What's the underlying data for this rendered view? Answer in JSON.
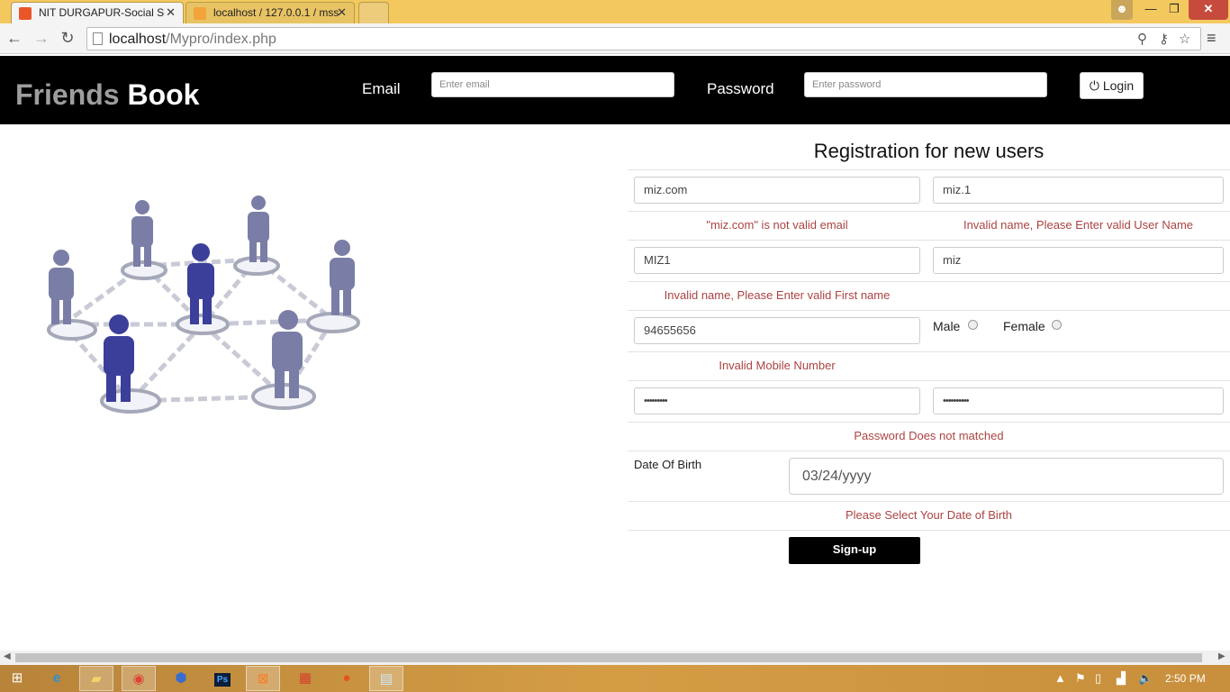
{
  "browser": {
    "tabs": [
      {
        "title": "NIT DURGAPUR-Social Site",
        "active": true,
        "favicon": "xampp-icon"
      },
      {
        "title": "localhost / 127.0.0.1 / mss",
        "active": false,
        "favicon": "phpmyadmin-icon"
      }
    ],
    "url_host": "localhost",
    "url_path": "/Mypro/index.php"
  },
  "header": {
    "brand_part1": "Friends",
    "brand_part2": "Book",
    "email_label": "Email",
    "email_placeholder": "Enter email",
    "password_label": "Password",
    "password_placeholder": "Enter password",
    "login_label": "Login"
  },
  "registration": {
    "title": "Registration for new users",
    "email_value": "miz.com",
    "username_value": "miz.1",
    "email_error": "\"miz.com\" is not valid email",
    "username_error": "Invalid name, Please Enter valid User Name",
    "firstname_value": "MIZ1",
    "lastname_value": "miz",
    "firstname_error": "Invalid name, Please Enter valid First name",
    "mobile_value": "94655656",
    "gender_male": "Male",
    "gender_female": "Female",
    "mobile_error": "Invalid Mobile Number",
    "password_value": "•••••••••",
    "confirm_password_value": "••••••••••",
    "password_error": "Password Does not matched",
    "dob_label": "Date Of Birth",
    "dob_value": "03/24/yyyy",
    "dob_error": "Please Select Your Date of Birth",
    "signup_label": "Sign-up"
  },
  "taskbar": {
    "clock": "2:50 PM"
  },
  "colors": {
    "header_bg": "#000000",
    "error_text": "#a94442",
    "chrome_frame": "#f3c95f"
  }
}
